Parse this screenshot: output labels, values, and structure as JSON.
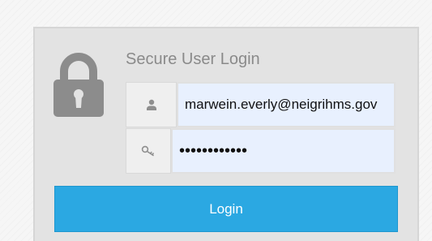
{
  "login": {
    "title": "Secure User Login",
    "username": {
      "value": "marwein.everly@neigrihms.gov",
      "icon": "user-icon"
    },
    "password": {
      "value": "••••••••••••",
      "icon": "key-icon"
    },
    "button_label": "Login",
    "lock_icon": "lock-icon"
  },
  "colors": {
    "button": "#2ba8e2",
    "input_background": "#e8f0fe",
    "panel": "#e3e3e3",
    "lock_icon": "#8c8c8c"
  }
}
